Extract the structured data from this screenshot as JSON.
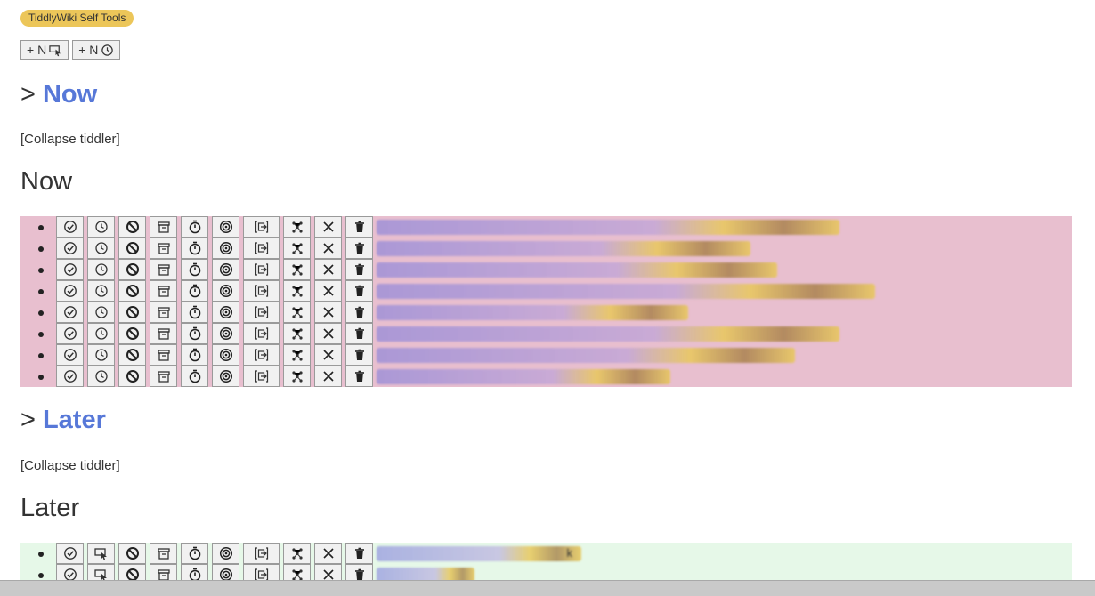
{
  "tag": {
    "label": "TiddlyWiki Self Tools"
  },
  "toolbar": {
    "buttons": [
      {
        "label": "+ N",
        "icon": "cursor-tab-icon"
      },
      {
        "label": "+ N",
        "icon": "history-icon"
      }
    ]
  },
  "sections": [
    {
      "caret": ">",
      "link": "Now",
      "collapse": "[Collapse tiddler]",
      "title": "Now",
      "bg": "#e8bfcf",
      "row_count": 8
    },
    {
      "caret": ">",
      "link": "Later",
      "collapse": "[Collapse tiddler]",
      "title": "Later",
      "bg": "#e6f8e8",
      "row_count": 2,
      "visible_suffix": "k"
    }
  ],
  "row_buttons": [
    "done-icon",
    "history-icon",
    "block-icon",
    "archive-icon",
    "timer-icon",
    "target-icon",
    "export-icon",
    "link-graph-icon",
    "close-icon",
    "trash-icon"
  ],
  "colors": {
    "tag_yellow": "#ecc659",
    "link_blue": "#5778d8",
    "now_bg": "#e8bfcf",
    "later_bg": "#e6f8e8"
  }
}
